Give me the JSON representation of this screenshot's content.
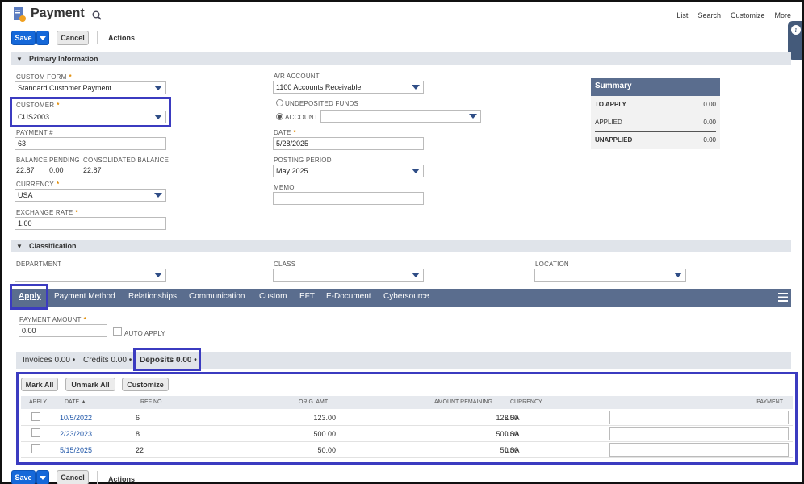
{
  "header": {
    "title": "Payment",
    "links": [
      "List",
      "Search",
      "Customize",
      "More"
    ]
  },
  "toolbar": {
    "save": "Save",
    "cancel": "Cancel",
    "actions": "Actions"
  },
  "primary": {
    "section_title": "Primary Information",
    "custom_form_label": "CUSTOM FORM",
    "custom_form_value": "Standard Customer Payment",
    "customer_label": "CUSTOMER",
    "customer_value": "CUS2003",
    "payment_no_label": "PAYMENT #",
    "payment_no_value": "63",
    "balance_label": "BALANCE",
    "balance_value": "22.87",
    "pending_label": "PENDING",
    "pending_value": "0.00",
    "consolidated_label": "CONSOLIDATED BALANCE",
    "consolidated_value": "22.87",
    "currency_label": "CURRENCY",
    "currency_value": "USA",
    "exchange_label": "EXCHANGE RATE",
    "exchange_value": "1.00",
    "ar_label": "A/R ACCOUNT",
    "ar_value": "1100 Accounts Receivable",
    "undeposited_label": "UNDEPOSITED FUNDS",
    "account_label": "ACCOUNT",
    "account_value": "",
    "date_label": "DATE",
    "date_value": "5/28/2025",
    "posting_label": "POSTING PERIOD",
    "posting_value": "May 2025",
    "memo_label": "MEMO",
    "memo_value": ""
  },
  "summary": {
    "title": "Summary",
    "to_apply_label": "TO APPLY",
    "to_apply_value": "0.00",
    "applied_label": "APPLIED",
    "applied_value": "0.00",
    "unapplied_label": "UNAPPLIED",
    "unapplied_value": "0.00"
  },
  "classification": {
    "section_title": "Classification",
    "department_label": "DEPARTMENT",
    "class_label": "CLASS",
    "location_label": "LOCATION"
  },
  "tabs": [
    "Apply",
    "Payment Method",
    "Relationships",
    "Communication",
    "Custom",
    "EFT",
    "E-Document",
    "Cybersource"
  ],
  "apply": {
    "payment_amount_label": "PAYMENT AMOUNT",
    "payment_amount_value": "0.00",
    "auto_apply_label": "AUTO APPLY",
    "subtabs": [
      "Invoices 0.00 •",
      "Credits 0.00 •",
      "Deposits 0.00 •"
    ],
    "buttons": [
      "Mark All",
      "Unmark All",
      "Customize"
    ],
    "columns": [
      "APPLY",
      "DATE ▲",
      "REF NO.",
      "ORIG. AMT.",
      "AMOUNT REMAINING",
      "CURRENCY",
      "PAYMENT"
    ],
    "rows": [
      {
        "date": "10/5/2022",
        "ref": "6",
        "orig": "123.00",
        "remaining": "123.00",
        "currency": "USA"
      },
      {
        "date": "2/23/2023",
        "ref": "8",
        "orig": "500.00",
        "remaining": "500.00",
        "currency": "USA"
      },
      {
        "date": "5/15/2025",
        "ref": "22",
        "orig": "50.00",
        "remaining": "50.00",
        "currency": "USA"
      }
    ]
  },
  "colors": {
    "accent": "#1568d9",
    "tabbar": "#5a6d8e",
    "highlight": "#3b3bc0"
  }
}
